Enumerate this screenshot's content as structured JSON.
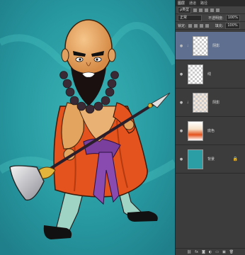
{
  "panel": {
    "tabs": [
      "图层",
      "通道",
      "路径"
    ],
    "kind_label": "ρ类型",
    "blend_mode": "正常",
    "opacity_label": "不透明度:",
    "opacity_value": "100%",
    "lock_label": "锁定:",
    "fill_label": "填充:",
    "fill_value": "100%",
    "layers": [
      {
        "name": "阴影"
      },
      {
        "name": "线"
      },
      {
        "name": "阴影"
      },
      {
        "name": "底色"
      },
      {
        "name": "背景"
      }
    ],
    "footer_icons": [
      "link-icon",
      "fx-icon",
      "mask-icon",
      "adjustment-icon",
      "group-icon",
      "new-layer-icon",
      "trash-icon"
    ]
  }
}
